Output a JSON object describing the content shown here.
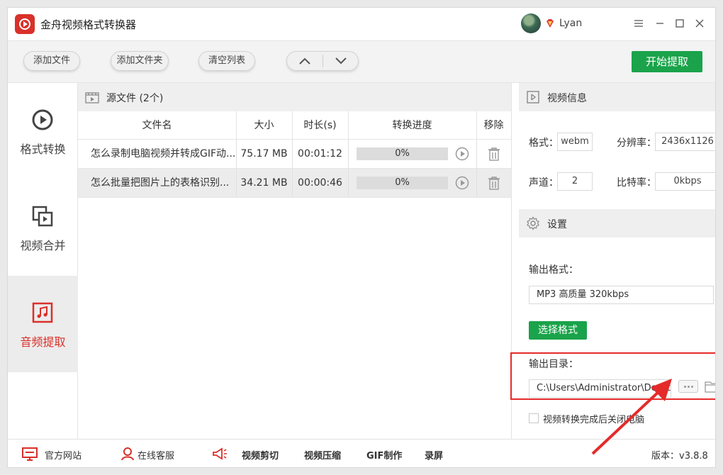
{
  "app": {
    "title": "金舟视频格式转换器",
    "user_name": "Lyan",
    "colors": {
      "brand_red": "#d9302a",
      "accent_green": "#1aa34a",
      "annotation_red": "#e52a2a"
    }
  },
  "toolbar": {
    "add_file": "添加文件",
    "add_folder": "添加文件夹",
    "clear_list": "清空列表",
    "move_up_icon": "chevron-up-icon",
    "move_down_icon": "chevron-down-icon",
    "start": "开始提取"
  },
  "sidebar": {
    "items": [
      {
        "label": "格式转换",
        "icon": "play-circle-icon",
        "active": false
      },
      {
        "label": "视频合并",
        "icon": "merge-icon",
        "active": false
      },
      {
        "label": "音频提取",
        "icon": "music-note-icon",
        "active": true
      }
    ]
  },
  "filelist": {
    "header": "源文件 (2个)",
    "columns": [
      "文件名",
      "大小",
      "时长(s)",
      "转换进度",
      "移除"
    ],
    "rows": [
      {
        "name": "怎么录制电脑视频并转成GIF动...",
        "size": "75.17 MB",
        "duration": "00:01:12",
        "progress_text": "0%",
        "progress": 0
      },
      {
        "name": "怎么批量把图片上的表格识别...",
        "size": "34.21 MB",
        "duration": "00:00:46",
        "progress_text": "0%",
        "progress": 0
      }
    ]
  },
  "video_info": {
    "title": "视频信息",
    "format_label": "格式：",
    "format_value": "webm",
    "resolution_label": "分辨率：",
    "resolution_value": "2436x1126",
    "channels_label": "声道：",
    "channels_value": "2",
    "bitrate_label": "比特率：",
    "bitrate_value": "0kbps"
  },
  "settings": {
    "title": "设置",
    "output_format_label": "输出格式：",
    "output_format_value": "MP3 高质量 320kbps",
    "choose_format": "选择格式",
    "output_dir_label": "输出目录：",
    "output_dir_value": "C:\\Users\\Administrator\\Deskto",
    "shutdown_label": "视频转换完成后关闭电脑"
  },
  "footer": {
    "official_site": "官方网站",
    "online_service": "在线客服",
    "video_edit": "视频剪切",
    "video_compress": "视频压缩",
    "gif_make": "GIF制作",
    "record": "录屏",
    "version": "版本：v3.8.8"
  }
}
